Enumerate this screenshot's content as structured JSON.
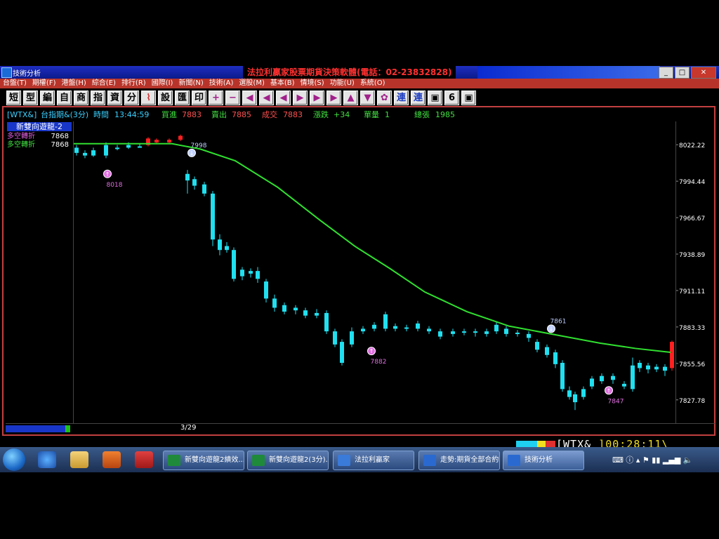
{
  "window": {
    "title": "技術分析",
    "banner": "法拉利贏家股票期貨決策軟體(電話：02-23832828)",
    "buttons": {
      "minimize": "_",
      "maximize": "□",
      "close": "✕"
    }
  },
  "menu": [
    "台盤(T)",
    "期權(F)",
    "港盤(H)",
    "綜合(E)",
    "排行(R)",
    "國際(I)",
    "新聞(N)",
    "技術(A)",
    "選股(M)",
    "基本(B)",
    "情境(S)",
    "功能(U)",
    "系統(O)"
  ],
  "toolbar": {
    "text_buttons": [
      "短",
      "型",
      "編",
      "自",
      "商",
      "指",
      "資",
      "分",
      "設",
      "匯",
      "印",
      "連",
      "連"
    ],
    "glyph_buttons": [
      "+",
      "−",
      "◀",
      "◀",
      "◀",
      "▶",
      "▶",
      "▶",
      "▲",
      "▼"
    ]
  },
  "info": {
    "symbol": "[WTX&]",
    "name": "台指期&(3分)",
    "time_label": "時間",
    "time": "13:44:59",
    "bid_label": "買進",
    "bid": "7883",
    "ask_label": "賣出",
    "ask": "7885",
    "trade_label": "成交",
    "trade": "7883",
    "change_label": "漲跌",
    "change": "+34",
    "vol_label": "單量",
    "vol": "1",
    "total_label": "總張",
    "total": "1985"
  },
  "panel": {
    "header": "新雙向遊龍-2",
    "rows": [
      {
        "label": "多空轉折",
        "value": "7868",
        "color": "#e060e0"
      },
      {
        "label": "多空轉折",
        "value": "7868",
        "color": "#40e040"
      }
    ]
  },
  "chart_data": {
    "type": "candlestick",
    "date_label": "3/29",
    "y_ticks": [
      "8022.22",
      "7994.44",
      "7966.67",
      "7938.89",
      "7911.11",
      "7883.33",
      "7855.56",
      "7827.78"
    ],
    "ylim": [
      7810,
      8040
    ],
    "ma_line": [
      [
        0,
        8023
      ],
      [
        60,
        8023
      ],
      [
        140,
        8023
      ],
      [
        180,
        8019
      ],
      [
        230,
        8010
      ],
      [
        290,
        7990
      ],
      [
        350,
        7965
      ],
      [
        400,
        7945
      ],
      [
        450,
        7928
      ],
      [
        500,
        7910
      ],
      [
        560,
        7895
      ],
      [
        620,
        7884
      ],
      [
        690,
        7877
      ],
      [
        750,
        7871
      ],
      [
        800,
        7867
      ],
      [
        850,
        7864
      ]
    ],
    "candles": [
      {
        "x": 4,
        "o": 8020,
        "c": 8016,
        "h": 8022,
        "l": 8014
      },
      {
        "x": 16,
        "o": 8016,
        "c": 8014,
        "h": 8018,
        "l": 8012
      },
      {
        "x": 28,
        "o": 8014,
        "c": 8018,
        "h": 8020,
        "l": 8013
      },
      {
        "x": 46,
        "o": 8014,
        "c": 8022,
        "h": 8024,
        "l": 8012
      },
      {
        "x": 62,
        "o": 8020,
        "c": 8020,
        "h": 8022,
        "l": 8018
      },
      {
        "x": 78,
        "o": 8020,
        "c": 8022,
        "h": 8024,
        "l": 8019
      },
      {
        "x": 94,
        "o": 8021,
        "c": 8021,
        "h": 8023,
        "l": 8020
      },
      {
        "x": 106,
        "o": 8022,
        "c": 8027,
        "h": 8028,
        "l": 8021,
        "up": true
      },
      {
        "x": 118,
        "o": 8024,
        "c": 8026,
        "h": 8027,
        "l": 8023,
        "up": true
      },
      {
        "x": 136,
        "o": 8024,
        "c": 8026,
        "h": 8027,
        "l": 8023,
        "up": true
      },
      {
        "x": 152,
        "o": 8026,
        "c": 8029,
        "h": 8030,
        "l": 8025,
        "up": true
      },
      {
        "x": 162,
        "o": 8000,
        "c": 7995,
        "h": 8003,
        "l": 7985
      },
      {
        "x": 172,
        "o": 7996,
        "c": 7991,
        "h": 7998,
        "l": 7988
      },
      {
        "x": 186,
        "o": 7992,
        "c": 7985,
        "h": 7994,
        "l": 7983
      },
      {
        "x": 198,
        "o": 7985,
        "c": 7950,
        "h": 7987,
        "l": 7945
      },
      {
        "x": 208,
        "o": 7950,
        "c": 7942,
        "h": 7954,
        "l": 7938
      },
      {
        "x": 218,
        "o": 7945,
        "c": 7942,
        "h": 7948,
        "l": 7940
      },
      {
        "x": 228,
        "o": 7942,
        "c": 7920,
        "h": 7944,
        "l": 7918
      },
      {
        "x": 240,
        "o": 7922,
        "c": 7927,
        "h": 7929,
        "l": 7919
      },
      {
        "x": 252,
        "o": 7926,
        "c": 7924,
        "h": 7928,
        "l": 7921
      },
      {
        "x": 262,
        "o": 7926,
        "c": 7920,
        "h": 7929,
        "l": 7917
      },
      {
        "x": 274,
        "o": 7918,
        "c": 7905,
        "h": 7920,
        "l": 7902
      },
      {
        "x": 286,
        "o": 7905,
        "c": 7898,
        "h": 7908,
        "l": 7895
      },
      {
        "x": 300,
        "o": 7900,
        "c": 7895,
        "h": 7902,
        "l": 7893
      },
      {
        "x": 316,
        "o": 7898,
        "c": 7896,
        "h": 7900,
        "l": 7893
      },
      {
        "x": 330,
        "o": 7896,
        "c": 7892,
        "h": 7898,
        "l": 7890
      },
      {
        "x": 346,
        "o": 7894,
        "c": 7892,
        "h": 7897,
        "l": 7890
      },
      {
        "x": 360,
        "o": 7894,
        "c": 7880,
        "h": 7896,
        "l": 7878
      },
      {
        "x": 372,
        "o": 7880,
        "c": 7870,
        "h": 7882,
        "l": 7868
      },
      {
        "x": 382,
        "o": 7872,
        "c": 7856,
        "h": 7874,
        "l": 7854
      },
      {
        "x": 396,
        "o": 7870,
        "c": 7880,
        "h": 7883,
        "l": 7868
      },
      {
        "x": 412,
        "o": 7882,
        "c": 7880,
        "h": 7884,
        "l": 7878
      },
      {
        "x": 428,
        "o": 7882,
        "c": 7885,
        "h": 7887,
        "l": 7880
      },
      {
        "x": 444,
        "o": 7882,
        "c": 7893,
        "h": 7895,
        "l": 7880
      },
      {
        "x": 458,
        "o": 7884,
        "c": 7882,
        "h": 7886,
        "l": 7880
      },
      {
        "x": 474,
        "o": 7883,
        "c": 7882,
        "h": 7885,
        "l": 7880
      },
      {
        "x": 490,
        "o": 7886,
        "c": 7882,
        "h": 7888,
        "l": 7880
      },
      {
        "x": 506,
        "o": 7882,
        "c": 7880,
        "h": 7884,
        "l": 7878
      },
      {
        "x": 522,
        "o": 7880,
        "c": 7876,
        "h": 7882,
        "l": 7874
      },
      {
        "x": 540,
        "o": 7880,
        "c": 7878,
        "h": 7882,
        "l": 7876
      },
      {
        "x": 556,
        "o": 7880,
        "c": 7879,
        "h": 7882,
        "l": 7877
      },
      {
        "x": 572,
        "o": 7879,
        "c": 7880,
        "h": 7882,
        "l": 7876
      },
      {
        "x": 588,
        "o": 7878,
        "c": 7880,
        "h": 7882,
        "l": 7876
      },
      {
        "x": 602,
        "o": 7880,
        "c": 7885,
        "h": 7887,
        "l": 7878
      },
      {
        "x": 616,
        "o": 7882,
        "c": 7878,
        "h": 7884,
        "l": 7876
      },
      {
        "x": 632,
        "o": 7879,
        "c": 7878,
        "h": 7881,
        "l": 7876
      },
      {
        "x": 648,
        "o": 7878,
        "c": 7875,
        "h": 7880,
        "l": 7872
      },
      {
        "x": 660,
        "o": 7872,
        "c": 7866,
        "h": 7874,
        "l": 7864
      },
      {
        "x": 674,
        "o": 7868,
        "c": 7862,
        "h": 7870,
        "l": 7860
      },
      {
        "x": 686,
        "o": 7864,
        "c": 7855,
        "h": 7866,
        "l": 7852
      },
      {
        "x": 696,
        "o": 7856,
        "c": 7836,
        "h": 7858,
        "l": 7834
      },
      {
        "x": 706,
        "o": 7835,
        "c": 7830,
        "h": 7838,
        "l": 7828
      },
      {
        "x": 714,
        "o": 7832,
        "c": 7826,
        "h": 7834,
        "l": 7820
      },
      {
        "x": 726,
        "o": 7830,
        "c": 7836,
        "h": 7838,
        "l": 7828
      },
      {
        "x": 738,
        "o": 7838,
        "c": 7844,
        "h": 7846,
        "l": 7836
      },
      {
        "x": 752,
        "o": 7842,
        "c": 7846,
        "h": 7848,
        "l": 7840
      },
      {
        "x": 768,
        "o": 7843,
        "c": 7846,
        "h": 7848,
        "l": 7840
      },
      {
        "x": 784,
        "o": 7840,
        "c": 7838,
        "h": 7842,
        "l": 7836
      },
      {
        "x": 796,
        "o": 7836,
        "c": 7854,
        "h": 7860,
        "l": 7834
      },
      {
        "x": 806,
        "o": 7856,
        "c": 7852,
        "h": 7858,
        "l": 7849
      },
      {
        "x": 818,
        "o": 7854,
        "c": 7851,
        "h": 7856,
        "l": 7848
      },
      {
        "x": 830,
        "o": 7853,
        "c": 7851,
        "h": 7855,
        "l": 7849
      },
      {
        "x": 842,
        "o": 7853,
        "c": 7850,
        "h": 7855,
        "l": 7846
      },
      {
        "x": 852,
        "o": 7852,
        "c": 7872,
        "h": 7873,
        "l": 7850,
        "up": true
      }
    ],
    "markers": [
      {
        "x": 48,
        "price": 8000,
        "label": "8018",
        "kind": "buy"
      },
      {
        "x": 168,
        "price": 8016,
        "label": "7998",
        "kind": "sell"
      },
      {
        "x": 424,
        "price": 7865,
        "label": "7882",
        "kind": "buy"
      },
      {
        "x": 680,
        "price": 7882,
        "label": "7861",
        "kind": "sell"
      },
      {
        "x": 762,
        "price": 7835,
        "label": "7847",
        "kind": "buy"
      }
    ]
  },
  "status": {
    "ticker": "[WTX&_",
    "clock": "]00:28:11\\"
  },
  "taskbar": {
    "buttons": [
      {
        "label": "新雙向遊龍2績效...",
        "color": "#1f8a3a"
      },
      {
        "label": "新雙向遊龍2(3分)...",
        "color": "#1f8a3a"
      },
      {
        "label": "法拉利贏家",
        "color": "#3a7ad8"
      },
      {
        "label": "走勢:期貨全部合約",
        "color": "#2a6ad0"
      },
      {
        "label": "技術分析",
        "color": "#2a6ad0"
      }
    ]
  }
}
